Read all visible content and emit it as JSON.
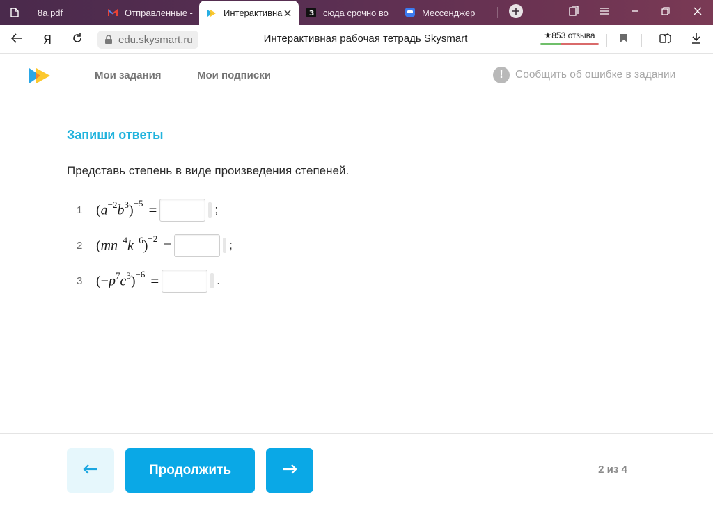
{
  "browser": {
    "tabs": [
      {
        "label": "8a.pdf",
        "icon": "file-icon"
      },
      {
        "label": "Отправленные -",
        "icon": "gmail-icon"
      },
      {
        "label": "Интерактивна",
        "icon": "skysmart-icon",
        "active": true
      },
      {
        "label": "сюда срочно во",
        "icon": "znanija-icon"
      },
      {
        "label": "Мессенджер",
        "icon": "messenger-icon"
      }
    ],
    "url": "edu.skysmart.ru",
    "page_title": "Интерактивная рабочая тетрадь Skysmart",
    "reviews": "★853 отзыва"
  },
  "site": {
    "nav": {
      "my_tasks": "Мои задания",
      "my_subscriptions": "Мои подписки"
    },
    "report_error": "Сообщить об ошибке в задании",
    "brand_colors": {
      "accent": "#22b3dd",
      "button": "#0aa8e6"
    }
  },
  "exercise": {
    "heading": "Запиши ответы",
    "instruction": "Представь степень в виде произведения степеней.",
    "tasks": [
      {
        "num": "1",
        "terminator": ";"
      },
      {
        "num": "2",
        "terminator": ";"
      },
      {
        "num": "3",
        "terminator": "."
      }
    ]
  },
  "footer": {
    "continue": "Продолжить",
    "pager": "2 из 4"
  }
}
